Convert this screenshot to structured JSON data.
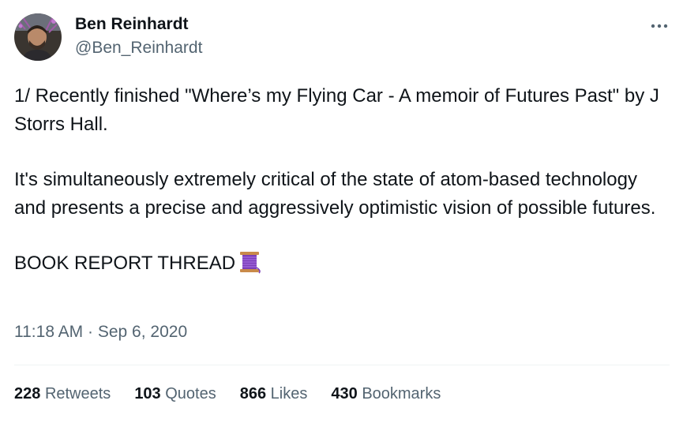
{
  "author": {
    "name": "Ben Reinhardt",
    "handle": "@Ben_Reinhardt"
  },
  "tweet": {
    "paragraphs": [
      "1/ Recently finished \"Where’s my Flying Car - A memoir of Futures Past\" by J Storrs Hall.",
      "It's simultaneously extremely critical of the state of atom-based technology and presents a precise and aggressively optimistic vision of possible futures.",
      "BOOK REPORT THREAD"
    ],
    "emoji_icon": "thread-spool-icon"
  },
  "meta": {
    "time": "11:18 AM",
    "separator": "·",
    "date": "Sep 6, 2020"
  },
  "stats": [
    {
      "count": "228",
      "label": "Retweets"
    },
    {
      "count": "103",
      "label": "Quotes"
    },
    {
      "count": "866",
      "label": "Likes"
    },
    {
      "count": "430",
      "label": "Bookmarks"
    }
  ],
  "icons": {
    "more": "more-options-icon"
  },
  "colors": {
    "text_primary": "#0f1419",
    "text_secondary": "#536471",
    "divider": "#eff3f4",
    "spool_thread": "#8a4fc7"
  }
}
